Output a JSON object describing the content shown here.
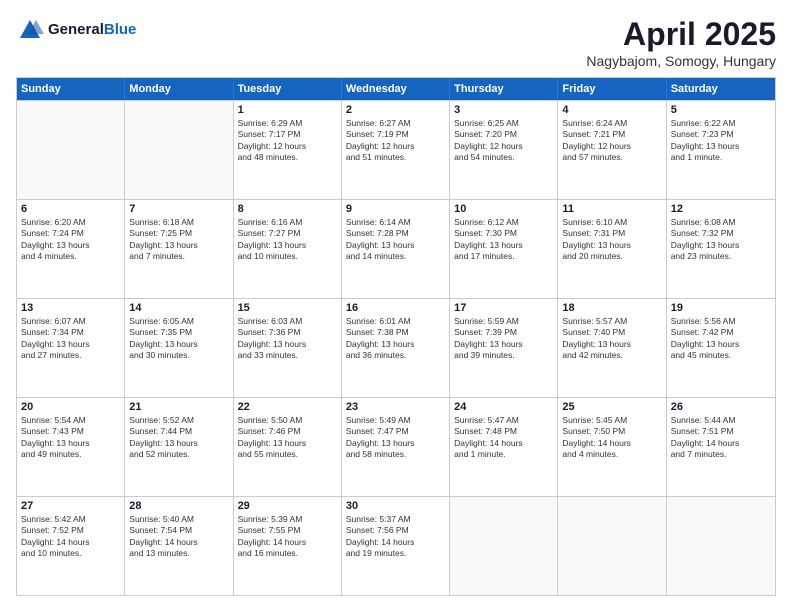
{
  "header": {
    "logo_line1": "General",
    "logo_line2": "Blue",
    "month": "April 2025",
    "location": "Nagybajom, Somogy, Hungary"
  },
  "weekdays": [
    "Sunday",
    "Monday",
    "Tuesday",
    "Wednesday",
    "Thursday",
    "Friday",
    "Saturday"
  ],
  "rows": [
    [
      {
        "day": "",
        "text": ""
      },
      {
        "day": "",
        "text": ""
      },
      {
        "day": "1",
        "text": "Sunrise: 6:29 AM\nSunset: 7:17 PM\nDaylight: 12 hours\nand 48 minutes."
      },
      {
        "day": "2",
        "text": "Sunrise: 6:27 AM\nSunset: 7:19 PM\nDaylight: 12 hours\nand 51 minutes."
      },
      {
        "day": "3",
        "text": "Sunrise: 6:25 AM\nSunset: 7:20 PM\nDaylight: 12 hours\nand 54 minutes."
      },
      {
        "day": "4",
        "text": "Sunrise: 6:24 AM\nSunset: 7:21 PM\nDaylight: 12 hours\nand 57 minutes."
      },
      {
        "day": "5",
        "text": "Sunrise: 6:22 AM\nSunset: 7:23 PM\nDaylight: 13 hours\nand 1 minute."
      }
    ],
    [
      {
        "day": "6",
        "text": "Sunrise: 6:20 AM\nSunset: 7:24 PM\nDaylight: 13 hours\nand 4 minutes."
      },
      {
        "day": "7",
        "text": "Sunrise: 6:18 AM\nSunset: 7:25 PM\nDaylight: 13 hours\nand 7 minutes."
      },
      {
        "day": "8",
        "text": "Sunrise: 6:16 AM\nSunset: 7:27 PM\nDaylight: 13 hours\nand 10 minutes."
      },
      {
        "day": "9",
        "text": "Sunrise: 6:14 AM\nSunset: 7:28 PM\nDaylight: 13 hours\nand 14 minutes."
      },
      {
        "day": "10",
        "text": "Sunrise: 6:12 AM\nSunset: 7:30 PM\nDaylight: 13 hours\nand 17 minutes."
      },
      {
        "day": "11",
        "text": "Sunrise: 6:10 AM\nSunset: 7:31 PM\nDaylight: 13 hours\nand 20 minutes."
      },
      {
        "day": "12",
        "text": "Sunrise: 6:08 AM\nSunset: 7:32 PM\nDaylight: 13 hours\nand 23 minutes."
      }
    ],
    [
      {
        "day": "13",
        "text": "Sunrise: 6:07 AM\nSunset: 7:34 PM\nDaylight: 13 hours\nand 27 minutes."
      },
      {
        "day": "14",
        "text": "Sunrise: 6:05 AM\nSunset: 7:35 PM\nDaylight: 13 hours\nand 30 minutes."
      },
      {
        "day": "15",
        "text": "Sunrise: 6:03 AM\nSunset: 7:36 PM\nDaylight: 13 hours\nand 33 minutes."
      },
      {
        "day": "16",
        "text": "Sunrise: 6:01 AM\nSunset: 7:38 PM\nDaylight: 13 hours\nand 36 minutes."
      },
      {
        "day": "17",
        "text": "Sunrise: 5:59 AM\nSunset: 7:39 PM\nDaylight: 13 hours\nand 39 minutes."
      },
      {
        "day": "18",
        "text": "Sunrise: 5:57 AM\nSunset: 7:40 PM\nDaylight: 13 hours\nand 42 minutes."
      },
      {
        "day": "19",
        "text": "Sunrise: 5:56 AM\nSunset: 7:42 PM\nDaylight: 13 hours\nand 45 minutes."
      }
    ],
    [
      {
        "day": "20",
        "text": "Sunrise: 5:54 AM\nSunset: 7:43 PM\nDaylight: 13 hours\nand 49 minutes."
      },
      {
        "day": "21",
        "text": "Sunrise: 5:52 AM\nSunset: 7:44 PM\nDaylight: 13 hours\nand 52 minutes."
      },
      {
        "day": "22",
        "text": "Sunrise: 5:50 AM\nSunset: 7:46 PM\nDaylight: 13 hours\nand 55 minutes."
      },
      {
        "day": "23",
        "text": "Sunrise: 5:49 AM\nSunset: 7:47 PM\nDaylight: 13 hours\nand 58 minutes."
      },
      {
        "day": "24",
        "text": "Sunrise: 5:47 AM\nSunset: 7:48 PM\nDaylight: 14 hours\nand 1 minute."
      },
      {
        "day": "25",
        "text": "Sunrise: 5:45 AM\nSunset: 7:50 PM\nDaylight: 14 hours\nand 4 minutes."
      },
      {
        "day": "26",
        "text": "Sunrise: 5:44 AM\nSunset: 7:51 PM\nDaylight: 14 hours\nand 7 minutes."
      }
    ],
    [
      {
        "day": "27",
        "text": "Sunrise: 5:42 AM\nSunset: 7:52 PM\nDaylight: 14 hours\nand 10 minutes."
      },
      {
        "day": "28",
        "text": "Sunrise: 5:40 AM\nSunset: 7:54 PM\nDaylight: 14 hours\nand 13 minutes."
      },
      {
        "day": "29",
        "text": "Sunrise: 5:39 AM\nSunset: 7:55 PM\nDaylight: 14 hours\nand 16 minutes."
      },
      {
        "day": "30",
        "text": "Sunrise: 5:37 AM\nSunset: 7:56 PM\nDaylight: 14 hours\nand 19 minutes."
      },
      {
        "day": "",
        "text": ""
      },
      {
        "day": "",
        "text": ""
      },
      {
        "day": "",
        "text": ""
      }
    ]
  ]
}
